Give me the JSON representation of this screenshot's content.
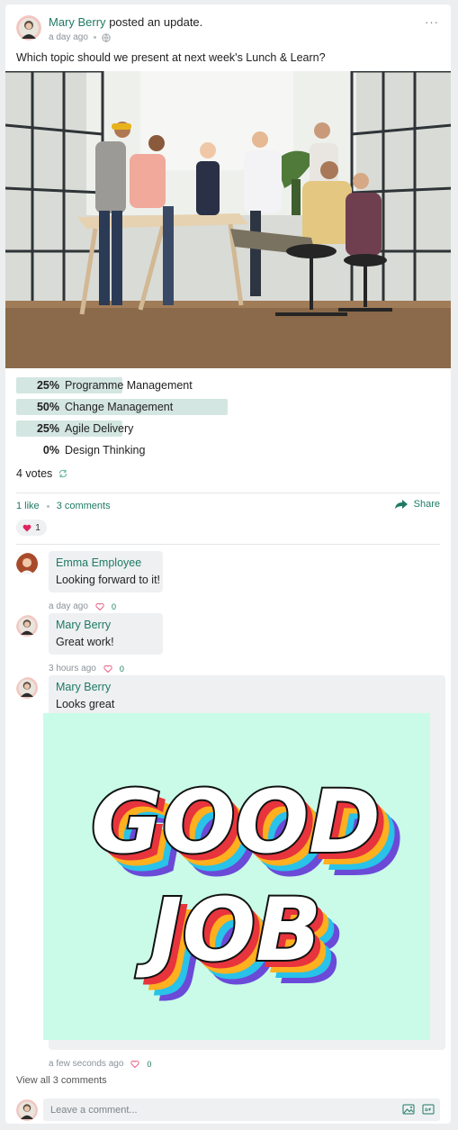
{
  "post": {
    "author": "Mary Berry",
    "action": "posted an update.",
    "time": "a day ago",
    "more": "···",
    "text": "Which topic should we present at next week's Lunch & Learn?"
  },
  "poll": {
    "options": [
      {
        "pct": "25%",
        "label": "Programme Management",
        "fraction": 0.25
      },
      {
        "pct": "50%",
        "label": "Change Management",
        "fraction": 0.5
      },
      {
        "pct": "25%",
        "label": "Agile Delivery",
        "fraction": 0.25
      },
      {
        "pct": "0%",
        "label": "Design Thinking",
        "fraction": 0
      }
    ],
    "votes": "4 votes"
  },
  "engagement": {
    "likes": "1 like",
    "comments": "3 comments",
    "share": "Share",
    "reaction_count": "1"
  },
  "comments": [
    {
      "name": "Emma Employee",
      "text": "Looking forward to it!",
      "time": "a day ago",
      "likes": "0"
    },
    {
      "name": "Mary Berry",
      "text": "Great work!",
      "time": "3 hours ago",
      "likes": "0"
    },
    {
      "name": "Mary Berry",
      "text": "Looks great",
      "time": "a few seconds ago",
      "likes": "0",
      "gif_text_line1": "GOOD",
      "gif_text_line2": "JOB"
    }
  ],
  "view_all": "View all 3 comments",
  "composer": {
    "placeholder": "Leave a comment..."
  },
  "colors": {
    "accent": "#1f7a63",
    "poll_fill": "#d4e6e1",
    "heart": "#e0245e"
  }
}
